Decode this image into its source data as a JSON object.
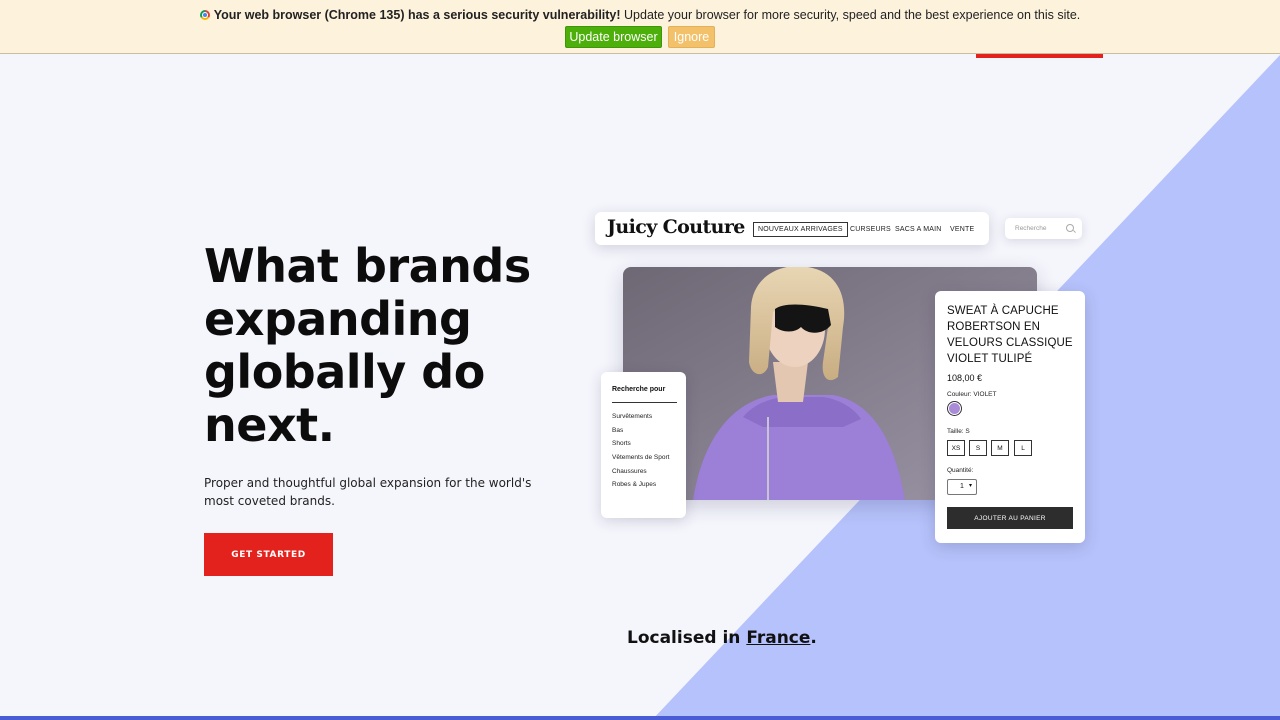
{
  "browser_warning": {
    "bold_text": "Your web browser (Chrome 135) has a serious security vulnerability!",
    "text": " Update your browser for more security, speed and the best experience on this site.",
    "update_label": "Update browser",
    "ignore_label": "Ignore",
    "icon": "chrome-icon"
  },
  "hero": {
    "title": "What brands expanding globally do next.",
    "subtitle": "Proper and thoughtful global expansion for the world's most coveted brands.",
    "cta_label": "GET STARTED"
  },
  "localised": {
    "prefix": "Localised in ",
    "country": "France",
    "suffix": "."
  },
  "store": {
    "logo": "Juicy Couture",
    "nav": [
      "NOUVEAUX ARRIVAGES",
      "CURSEURS",
      "SACS A MAIN",
      "VENTE"
    ],
    "search_placeholder": "Recherche",
    "filter": {
      "title": "Recherche pour",
      "items": [
        "Survêtements",
        "Bas",
        "Shorts",
        "Vêtements de Sport",
        "Chaussures",
        "Robes & Jupes"
      ]
    },
    "product": {
      "name": "SWEAT À CAPUCHE ROBERTSON EN VELOURS CLASSIQUE VIOLET TULIPÉ",
      "price": "108,00 €",
      "color_label": "Couleur: VIOLET",
      "swatch_color": "#a98bd8",
      "size_label": "Taille: S",
      "sizes": [
        "XS",
        "S",
        "M",
        "L"
      ],
      "qty_label": "Quantité:",
      "qty_value": "1",
      "add_label": "AJOUTER AU PANIER"
    }
  },
  "colors": {
    "accent_red": "#e3221d",
    "diagonal_blue": "#b6c2fb",
    "background": "#f5f6fc"
  }
}
